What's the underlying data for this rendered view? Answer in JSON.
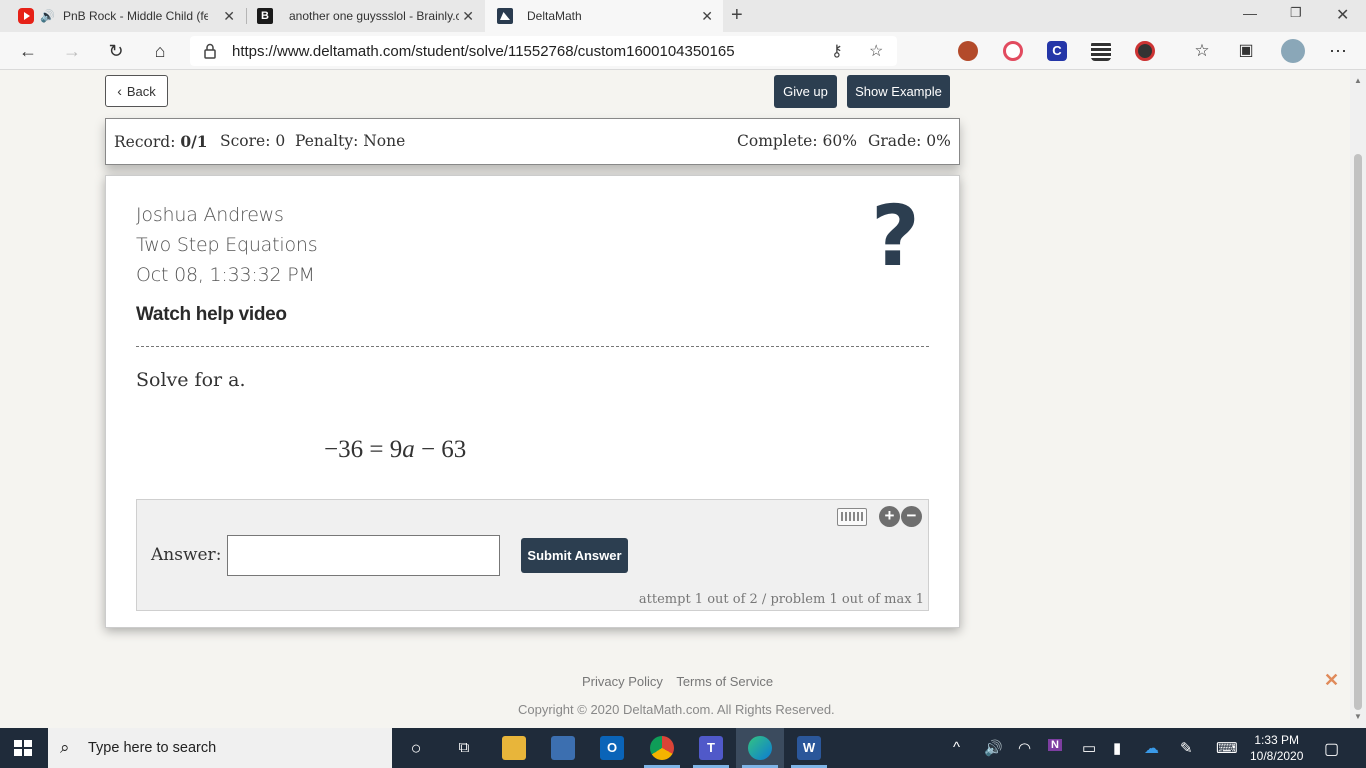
{
  "browser": {
    "tabs": [
      {
        "title": "PnB Rock - Middle Child (fe",
        "audio_icon": "speaker-icon"
      },
      {
        "title": "another one guyssslol - Brainly.c"
      },
      {
        "title": "DeltaMath"
      }
    ],
    "url": "https://www.deltamath.com/student/solve/11552768/custom1600104350165"
  },
  "page": {
    "back_label": "Back",
    "give_up_label": "Give up",
    "show_example_label": "Show Example",
    "record": {
      "record_label": "Record:",
      "record_value": "0/1",
      "score": "Score: 0",
      "penalty": "Penalty: None",
      "complete": "Complete: 60%",
      "grade": "Grade: 0%"
    },
    "problem": {
      "student_name": "Joshua Andrews",
      "assignment": "Two Step Equations",
      "datetime": "Oct 08, 1:33:32 PM",
      "help_link": "Watch help video",
      "prompt": "Solve for a.",
      "equation": {
        "lhs": "−36 = 9",
        "var": "a",
        "rhs": " − 63"
      }
    },
    "answer": {
      "label": "Answer:",
      "value": "",
      "submit_label": "Submit Answer",
      "attempt_text": "attempt 1 out of 2 / problem 1 out of max 1"
    },
    "footer": {
      "privacy": "Privacy Policy",
      "terms": "Terms of Service",
      "copyright": "Copyright © 2020 DeltaMath.com. All Rights Reserved."
    }
  },
  "taskbar": {
    "search_placeholder": "Type here to search",
    "time": "1:33 PM",
    "date": "10/8/2020"
  },
  "colors": {
    "dark_navy": "#2c3e50",
    "page_bg": "#f5f4f0",
    "taskbar_bg": "#1f2b3a"
  }
}
